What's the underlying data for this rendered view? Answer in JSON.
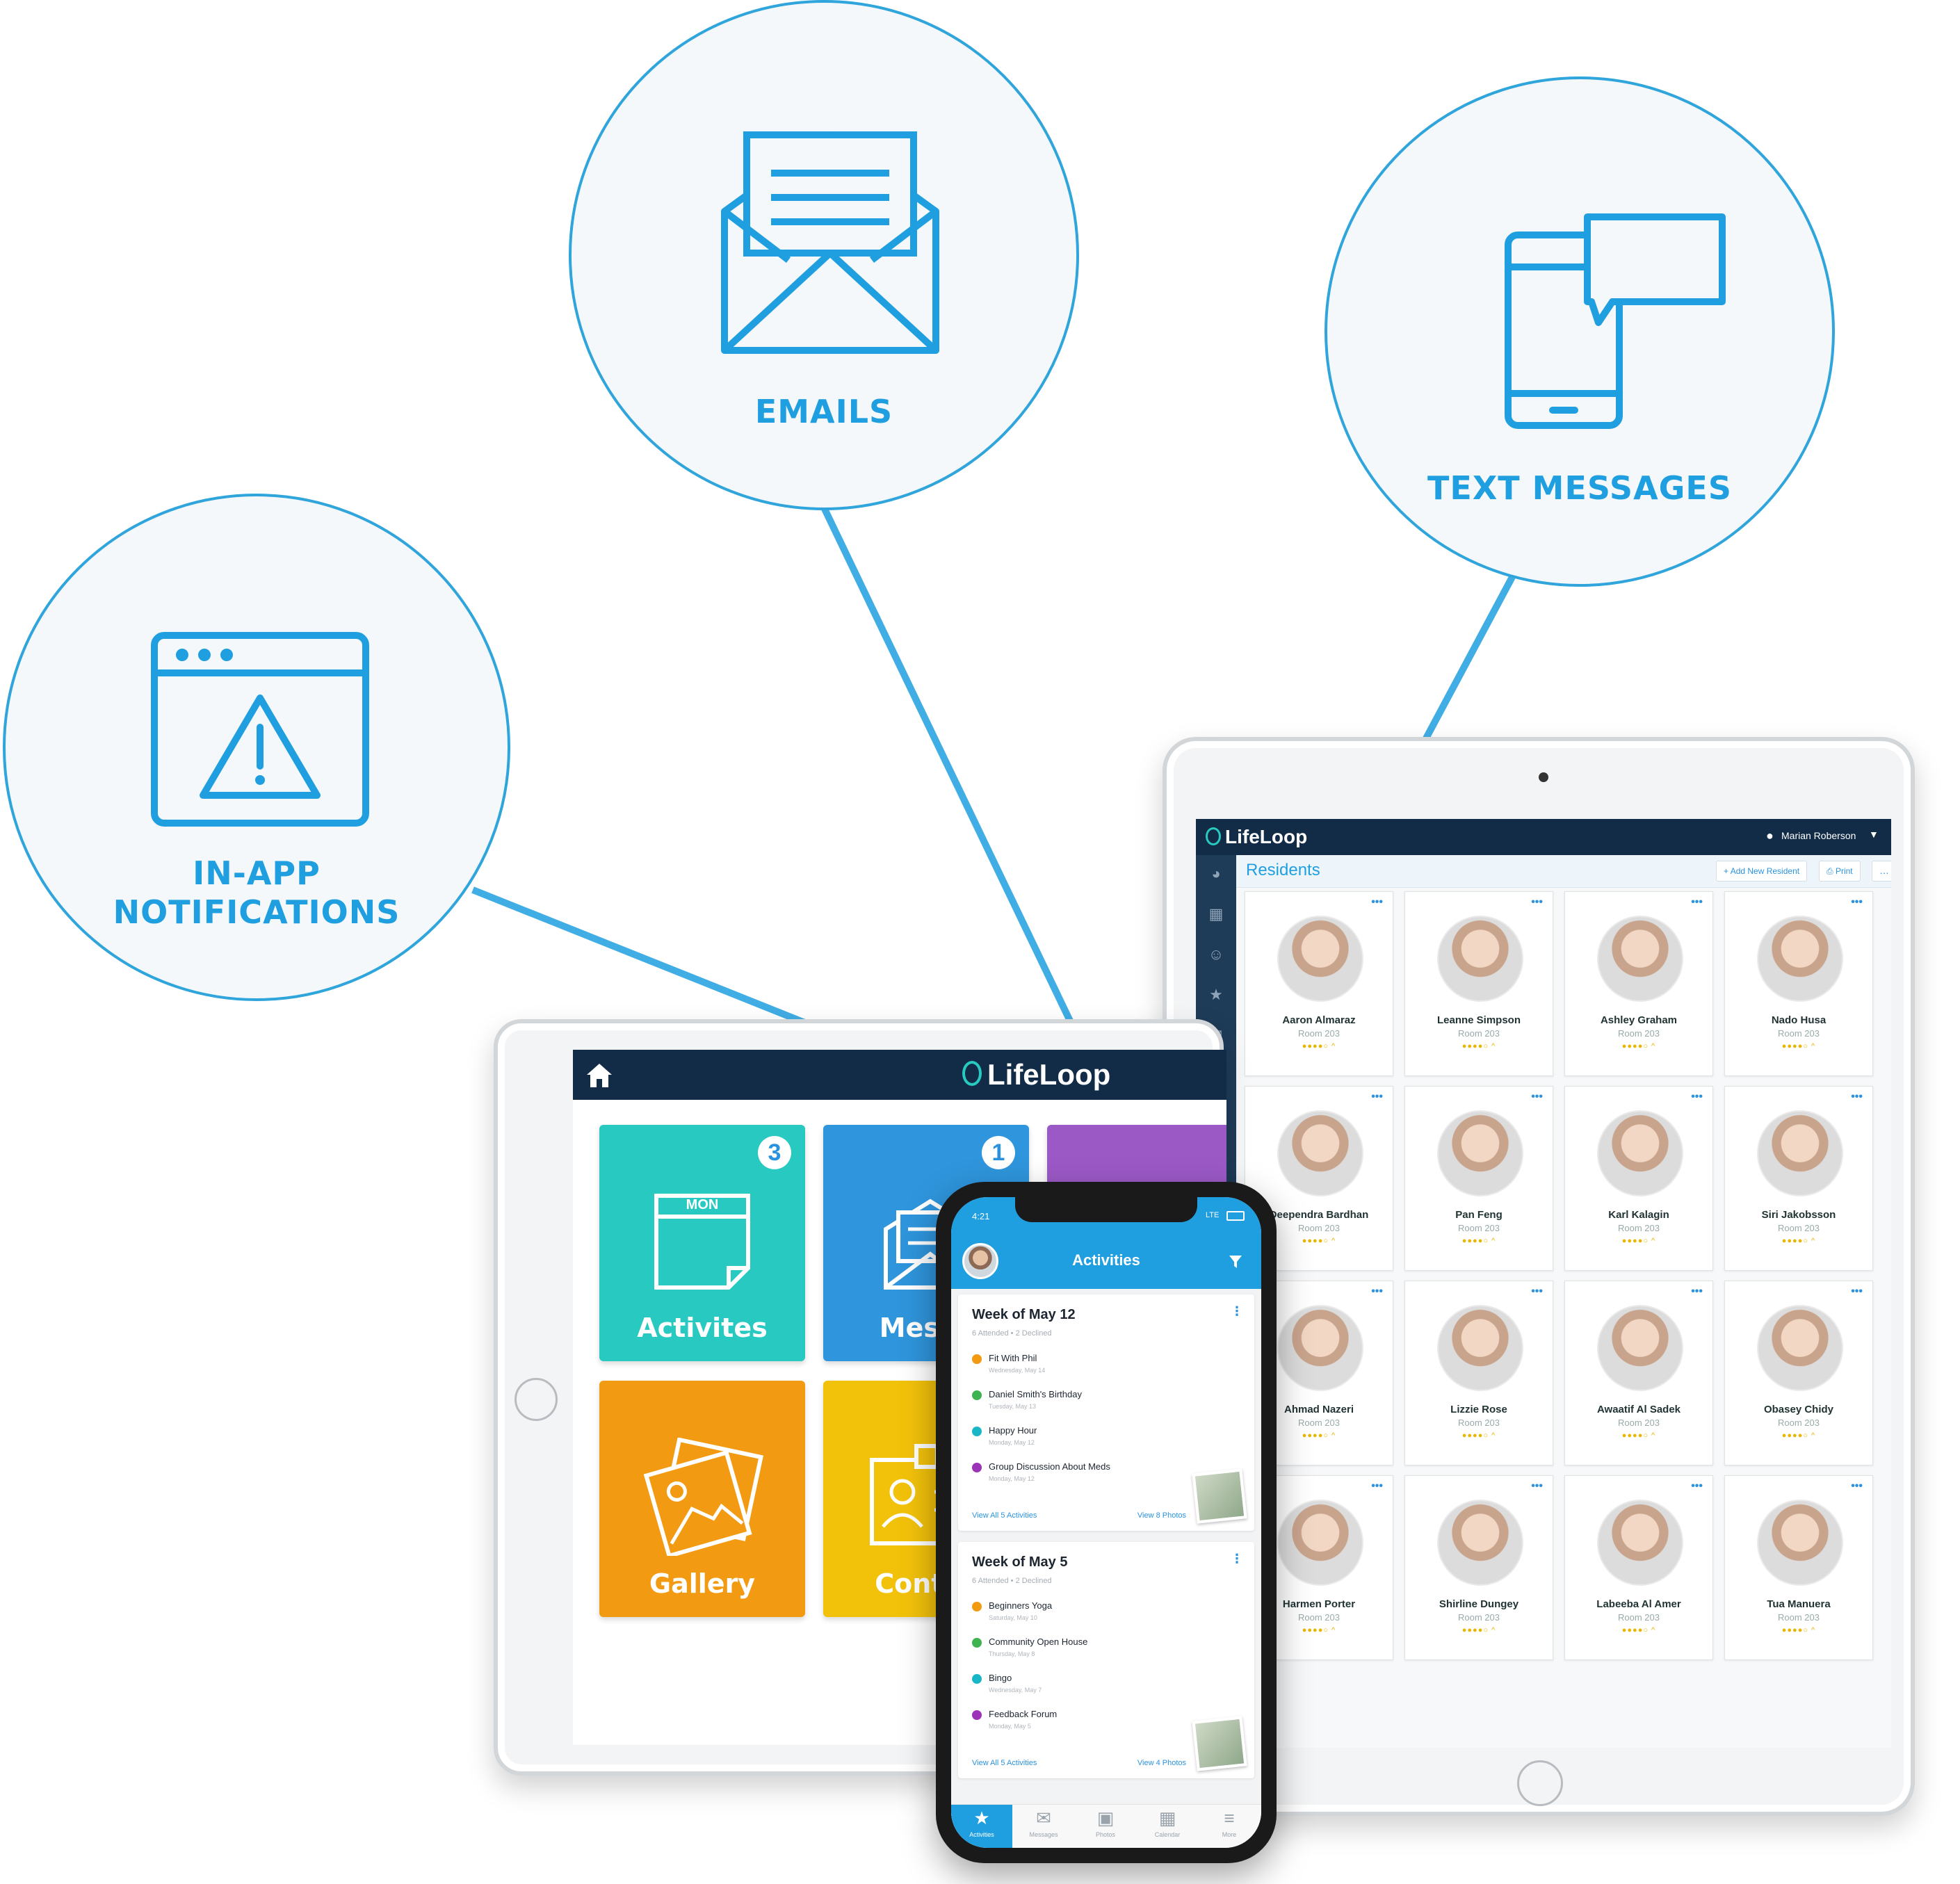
{
  "callouts": {
    "notifications": {
      "line1": "IN-APP",
      "line2": "NOTIFICATIONS",
      "icon": "browser-alert-icon"
    },
    "emails": {
      "label": "EMAILS",
      "icon": "open-envelope-icon"
    },
    "texts": {
      "label": "TEXT MESSAGES",
      "icon": "phone-chat-icon"
    }
  },
  "colors": {
    "accent": "#1f9fe0",
    "navy": "#122c47",
    "teal": "#27c9c0",
    "blue": "#2f95dc",
    "purple": "#9b59c6",
    "orange": "#f29a12",
    "yellow": "#f2c20a"
  },
  "left_tablet": {
    "brand": "LifeLoop",
    "tiles": [
      {
        "label": "Activites",
        "badge": "3",
        "icon_text": "MON"
      },
      {
        "label": "Messa",
        "badge": "1"
      },
      {
        "label": "Gallery"
      },
      {
        "label": "Contac"
      }
    ]
  },
  "right_tablet": {
    "brand": "LifeLoop",
    "user": "Marian Roberson",
    "page_title": "Residents",
    "add_button": "Add New Resident",
    "print_button": "Print",
    "more_button": "…",
    "residents": [
      {
        "name": "Aaron Almaraz",
        "room": "Room 203"
      },
      {
        "name": "Leanne Simpson",
        "room": "Room 203"
      },
      {
        "name": "Ashley Graham",
        "room": "Room 203"
      },
      {
        "name": "Nado Husa",
        "room": "Room 203"
      },
      {
        "name": "Deependra Bardhan",
        "room": "Room 203"
      },
      {
        "name": "Pan Feng",
        "room": "Room 203"
      },
      {
        "name": "Karl Kalagin",
        "room": "Room 203"
      },
      {
        "name": "Siri Jakobsson",
        "room": "Room 203"
      },
      {
        "name": "Ahmad Nazeri",
        "room": "Room 203"
      },
      {
        "name": "Lizzie Rose",
        "room": "Room 203"
      },
      {
        "name": "Awaatif Al Sadek",
        "room": "Room 203"
      },
      {
        "name": "Obasey Chidy",
        "room": "Room 203"
      },
      {
        "name": "Harmen Porter",
        "room": "Room 203"
      },
      {
        "name": "Shirline Dungey",
        "room": "Room 203"
      },
      {
        "name": "Labeeba Al Amer",
        "room": "Room 203"
      },
      {
        "name": "Tua Manuera",
        "room": "Room 203"
      }
    ]
  },
  "phone": {
    "time": "4:21",
    "signal": "LTE",
    "title": "Activities",
    "weeks": [
      {
        "title": "Week of May 12",
        "attended": "6 Attended",
        "declined": "2 Declined",
        "events": [
          {
            "title": "Fit With Phil",
            "date": "Wednesday, May 14",
            "color": "#f29a12"
          },
          {
            "title": "Daniel Smith's Birthday",
            "date": "Tuesday, May 13",
            "color": "#3fb34f"
          },
          {
            "title": "Happy Hour",
            "date": "Monday, May 12",
            "color": "#19b6c8"
          },
          {
            "title": "Group Discussion About Meds",
            "date": "Monday, May 12",
            "color": "#9b34b7"
          }
        ],
        "view_activities": "View All 5 Activities",
        "view_photos": "View 8 Photos"
      },
      {
        "title": "Week of May 5",
        "attended": "6 Attended",
        "declined": "2 Declined",
        "events": [
          {
            "title": "Beginners Yoga",
            "date": "Saturday, May 10",
            "color": "#f29a12"
          },
          {
            "title": "Community Open House",
            "date": "Thursday, May 8",
            "color": "#3fb34f"
          },
          {
            "title": "Bingo",
            "date": "Wednesday, May 7",
            "color": "#19b6c8"
          },
          {
            "title": "Feedback Forum",
            "date": "Monday, May 5",
            "color": "#9b34b7"
          }
        ],
        "view_activities": "View All 5 Activities",
        "view_photos": "View 4 Photos"
      }
    ],
    "tabs": [
      "Activities",
      "Messages",
      "Photos",
      "Calendar",
      "More"
    ]
  }
}
